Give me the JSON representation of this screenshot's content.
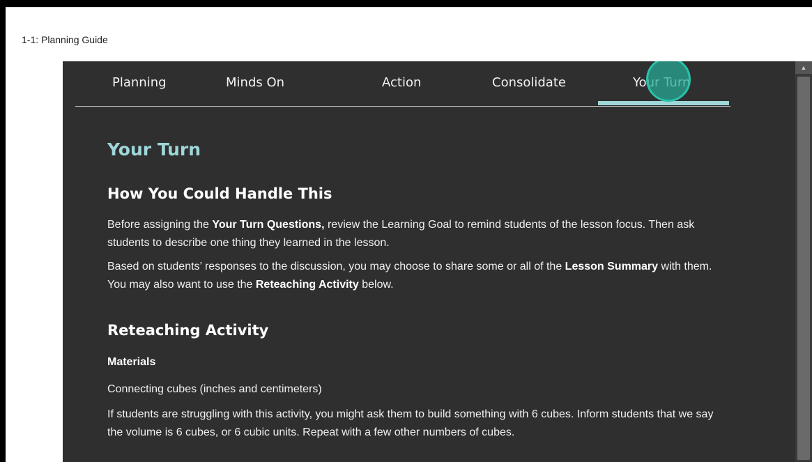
{
  "window": {
    "title": "1-1: Planning Guide"
  },
  "tabs": [
    {
      "label": "Planning"
    },
    {
      "label": "Minds On"
    },
    {
      "label": "Action"
    },
    {
      "label": "Consolidate"
    },
    {
      "label": "Your Turn",
      "active": true
    }
  ],
  "content": {
    "title": "Your Turn",
    "section1": {
      "heading": "How You Could Handle This",
      "p1": {
        "a": "Before assigning the ",
        "b": "Your Turn Questions,",
        "c": " review the Learning Goal to remind students of the lesson focus. Then ask students to describe one thing they learned in the lesson."
      },
      "p2": {
        "a": "Based on students’ responses to the discussion, you may choose to share some or all of the ",
        "b": "Lesson Summary",
        "c": " with them. You may also want to use the ",
        "d": "Reteaching Activity",
        "e": " below."
      }
    },
    "section2": {
      "heading": "Reteaching Activity",
      "subheading": "Materials",
      "materials": "Connecting cubes (inches and centimeters)",
      "p3": "If students are struggling with this activity, you might ask them to build something with 6 cubes. Inform students that we say the volume is 6 cubes, or 6 cubic units. Repeat with a few other numbers of cubes."
    }
  },
  "colors": {
    "background": "#2f2f2f",
    "accent": "#9fd6d8",
    "cursor": "#26aa96"
  }
}
